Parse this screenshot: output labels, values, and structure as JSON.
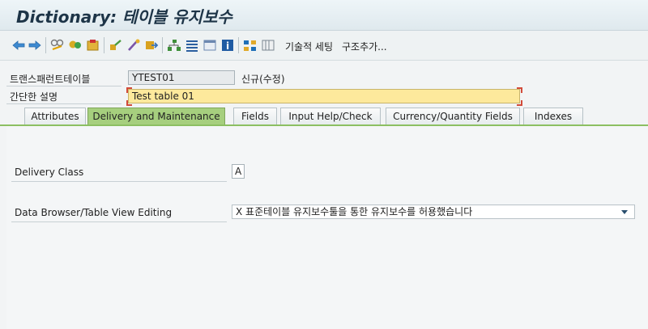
{
  "title": "Dictionary: 테이블 유지보수",
  "toolbar": {
    "icons": [
      "back-arrow-icon",
      "forward-arrow-icon",
      "display-change-icon",
      "other-object-icon",
      "activate-icon",
      "check-icon",
      "where-used-icon",
      "navigation-icon",
      "hierarchy-icon",
      "object-list-icon",
      "window-icon",
      "info-icon",
      "graphic-icon",
      "layout-icon"
    ],
    "technical_settings": "기술적 세팅",
    "append_structure": "구조추가..."
  },
  "fields": {
    "transparent_table_label": "트랜스패런트테이블",
    "transparent_table_value": "YTEST01",
    "status": "신규(수정)",
    "short_desc_label": "간단한 설명",
    "short_desc_value": "Test table 01"
  },
  "tabs": [
    {
      "label": "Attributes"
    },
    {
      "label": "Delivery and Maintenance",
      "active": true
    },
    {
      "label": "Fields"
    },
    {
      "label": "Input Help/Check"
    },
    {
      "label": "Currency/Quantity Fields"
    },
    {
      "label": "Indexes"
    }
  ],
  "delivery": {
    "delivery_class_label": "Delivery Class",
    "delivery_class_value": "A",
    "browser_label": "Data Browser/Table View Editing",
    "browser_value": "X 표준테이블 유지보수툴을 통한 유지보수를 허용했습니다"
  },
  "colors": {
    "active_tab": "#a6cf7e",
    "required_field": "#fde99c",
    "title_text": "#1d3447"
  }
}
